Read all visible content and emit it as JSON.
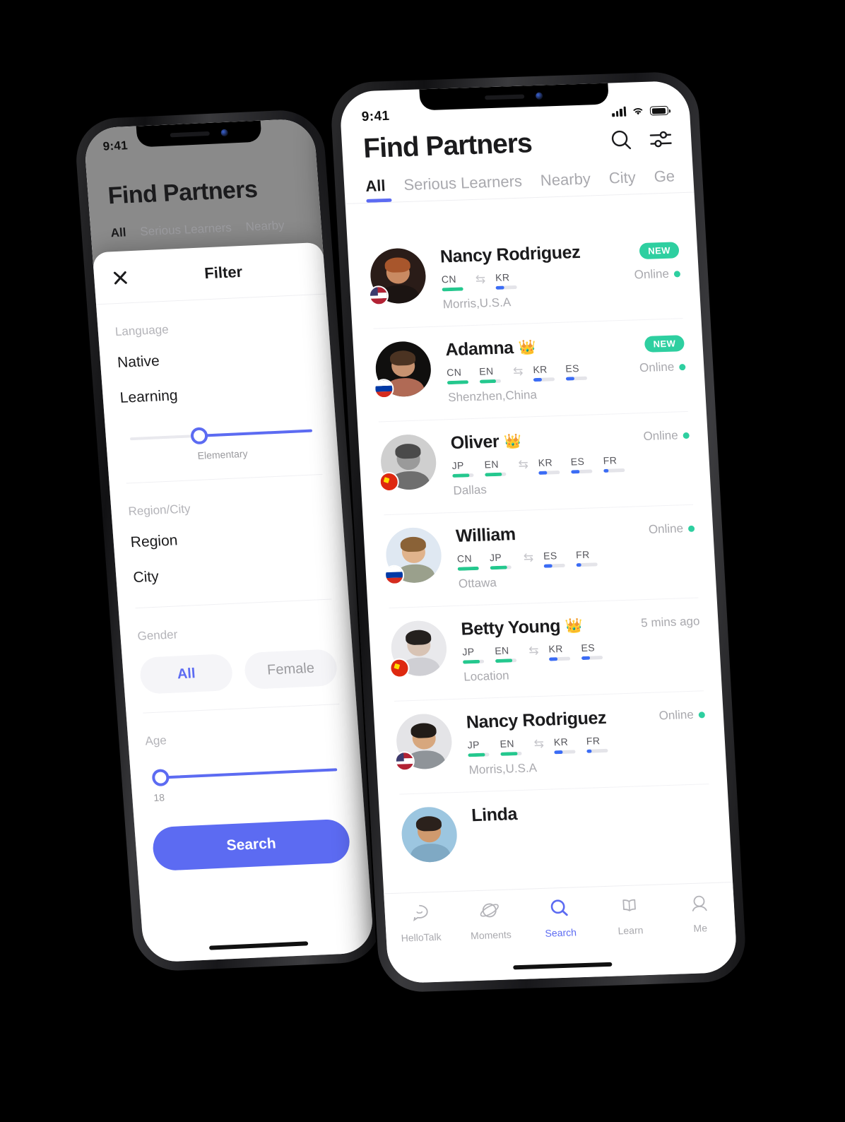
{
  "scene": {
    "background": "#000000",
    "accent": "#5c6bf2",
    "green": "#2ecfa0"
  },
  "left_phone": {
    "status": {
      "time": "9:41"
    },
    "background_screen": {
      "title": "Find Partners",
      "tabs": [
        "All",
        "Serious Learners",
        "Nearby"
      ]
    },
    "filter_sheet": {
      "close_icon": "close-icon",
      "title": "Filter",
      "sections": [
        {
          "caption": "Language",
          "rows": [
            "Native",
            "Learning"
          ],
          "slider": {
            "label": "Elementary",
            "position_pct": 38
          }
        },
        {
          "caption": "Region/City",
          "rows": [
            "Region",
            "City"
          ]
        },
        {
          "caption": "Gender",
          "chips": [
            {
              "label": "All",
              "selected": true
            },
            {
              "label": "Female",
              "selected": false
            }
          ]
        },
        {
          "caption": "Age",
          "slider": {
            "label": "18",
            "position_pct": 3
          }
        }
      ],
      "search_button": "Search"
    }
  },
  "right_phone": {
    "status": {
      "time": "9:41",
      "signal_icon": "signal-bars-icon",
      "wifi_icon": "wifi-icon",
      "battery_icon": "battery-icon"
    },
    "header": {
      "title": "Find Partners",
      "search_icon": "search-icon",
      "filter_icon": "filter-sliders-icon"
    },
    "tabs": [
      {
        "label": "All",
        "active": true
      },
      {
        "label": "Serious Learners",
        "active": false
      },
      {
        "label": "Nearby",
        "active": false
      },
      {
        "label": "City",
        "active": false
      },
      {
        "label": "Ge",
        "active": false
      }
    ],
    "partners": [
      {
        "name": "Nancy Rodriguez",
        "crown": "",
        "flag": "us",
        "avatar": {
          "bg": "#2a1c18",
          "skin": "#c98a62",
          "hair": "#a8562c",
          "shirt": "#1b1412"
        },
        "native": [
          {
            "code": "CN",
            "level": 100
          }
        ],
        "learning": [
          {
            "code": "KR",
            "level": 40
          }
        ],
        "location": "Morris,U.S.A",
        "badge": "NEW",
        "status": "Online",
        "online": true
      },
      {
        "name": "Adamna",
        "crown": "gold",
        "flag": "ru",
        "avatar": {
          "bg": "#100f0e",
          "skin": "#c79270",
          "hair": "#4b3322",
          "shirt": "#b06a55"
        },
        "native": [
          {
            "code": "CN",
            "level": 100
          },
          {
            "code": "EN",
            "level": 75
          }
        ],
        "learning": [
          {
            "code": "KR",
            "level": 40
          },
          {
            "code": "ES",
            "level": 40
          }
        ],
        "location": "Shenzhen,China",
        "badge": "NEW",
        "status": "Online",
        "online": true
      },
      {
        "name": "Oliver",
        "crown": "orange",
        "flag": "cn",
        "avatar": {
          "bg": "#cfcfcf",
          "skin": "#9a9a9a",
          "hair": "#4a4a4a",
          "shirt": "#6e6e6e"
        },
        "native": [
          {
            "code": "JP",
            "level": 80
          },
          {
            "code": "EN",
            "level": 80
          }
        ],
        "learning": [
          {
            "code": "KR",
            "level": 40
          },
          {
            "code": "ES",
            "level": 40
          },
          {
            "code": "FR",
            "level": 22
          }
        ],
        "location": "Dallas",
        "badge": "",
        "status": "Online",
        "online": true
      },
      {
        "name": "William",
        "crown": "",
        "flag": "ru",
        "avatar": {
          "bg": "#dfe8f2",
          "skin": "#e0b38c",
          "hair": "#8a6237",
          "shirt": "#9aa08c"
        },
        "native": [
          {
            "code": "CN",
            "level": 100
          },
          {
            "code": "JP",
            "level": 80
          }
        ],
        "learning": [
          {
            "code": "ES",
            "level": 40
          },
          {
            "code": "FR",
            "level": 22
          }
        ],
        "location": "Ottawa",
        "badge": "",
        "status": "Online",
        "online": true
      },
      {
        "name": "Betty Young",
        "crown": "gold",
        "flag": "cn",
        "avatar": {
          "bg": "#e9e9ec",
          "skin": "#d8c3b4",
          "hair": "#24201e",
          "shirt": "#cfcfd4"
        },
        "native": [
          {
            "code": "JP",
            "level": 80
          },
          {
            "code": "EN",
            "level": 80
          }
        ],
        "learning": [
          {
            "code": "KR",
            "level": 40
          },
          {
            "code": "ES",
            "level": 40
          }
        ],
        "location": "Location",
        "badge": "",
        "status": "5 mins ago",
        "online": false
      },
      {
        "name": "Nancy Rodriguez",
        "crown": "",
        "flag": "us",
        "avatar": {
          "bg": "#e4e4e7",
          "skin": "#d7a77e",
          "hair": "#211c18",
          "shirt": "#8f9499"
        },
        "native": [
          {
            "code": "JP",
            "level": 80
          },
          {
            "code": "EN",
            "level": 80
          }
        ],
        "learning": [
          {
            "code": "KR",
            "level": 40
          },
          {
            "code": "FR",
            "level": 22
          }
        ],
        "location": "Morris,U.S.A",
        "badge": "",
        "status": "Online",
        "online": true
      },
      {
        "name": "Linda",
        "crown": "",
        "flag": "",
        "avatar": {
          "bg": "#9cc6e0",
          "skin": "#cf9a6e",
          "hair": "#2b211c",
          "shirt": "#7fa9c4"
        },
        "native": [],
        "learning": [],
        "location": "",
        "badge": "",
        "status": "",
        "online": false
      }
    ],
    "tabbar": [
      {
        "label": "HelloTalk",
        "icon": "chat-bubble-icon",
        "active": false
      },
      {
        "label": "Moments",
        "icon": "planet-icon",
        "active": false
      },
      {
        "label": "Search",
        "icon": "search-icon",
        "active": true
      },
      {
        "label": "Learn",
        "icon": "book-icon",
        "active": false
      },
      {
        "label": "Me",
        "icon": "person-icon",
        "active": false
      }
    ]
  }
}
